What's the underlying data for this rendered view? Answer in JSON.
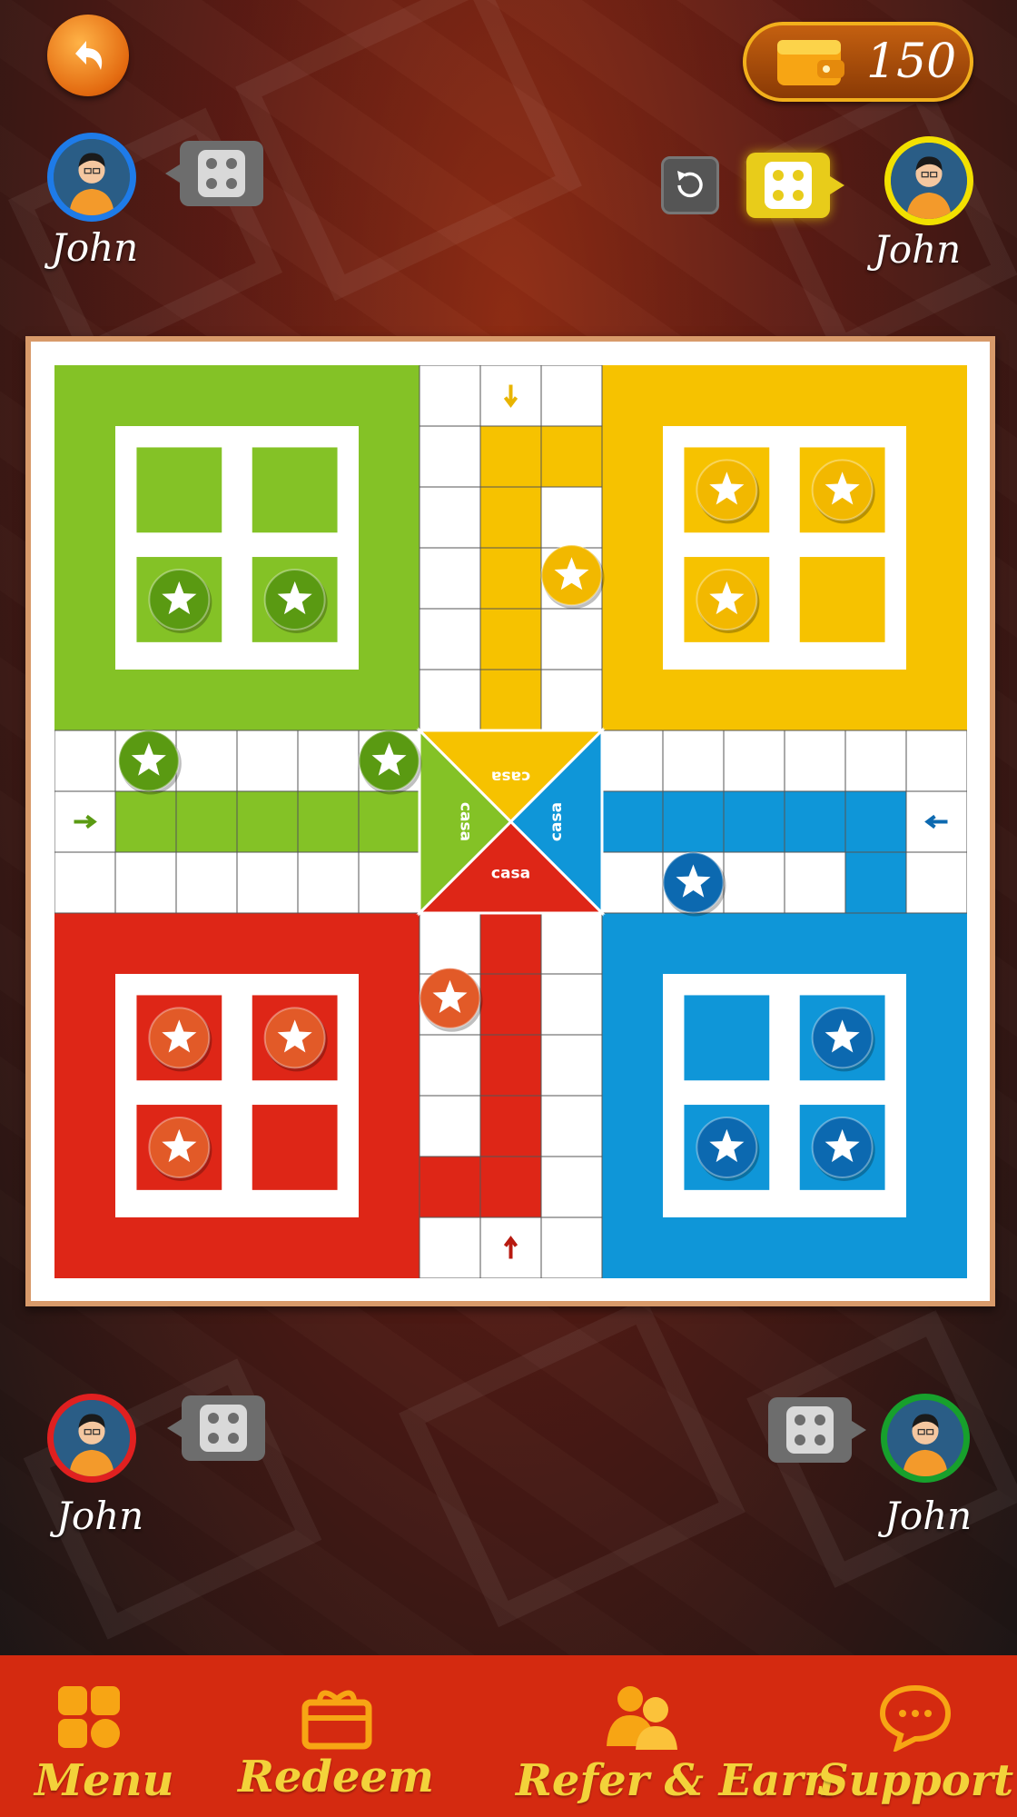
{
  "header": {
    "back_icon": "back-arrow-icon",
    "wallet_icon": "wallet-icon",
    "coins": "150",
    "undo_icon": "undo-icon"
  },
  "players": {
    "blue": {
      "name": "John",
      "ring_color": "#1e7be8"
    },
    "yellow": {
      "name": "John",
      "ring_color": "#f2e000"
    },
    "red": {
      "name": "John",
      "ring_color": "#e02020"
    },
    "green": {
      "name": "John",
      "ring_color": "#17a02c"
    }
  },
  "board": {
    "center_labels": [
      "casa",
      "casa",
      "casa",
      "casa"
    ],
    "colors": {
      "green": "#84c226",
      "yellow": "#f6c200",
      "blue": "#0f96d8",
      "red": "#de2617",
      "green_token": "#5a9a12",
      "yellow_token": "#f2b800",
      "blue_token": "#0c69b0",
      "red_token": "#e25a28"
    },
    "dice_value": 4
  },
  "nav": {
    "menu_label": "Menu",
    "redeem_label": "Redeem",
    "refer_label": "Refer & Earn",
    "support_label": "Support",
    "menu_icon": "grid-icon",
    "redeem_icon": "gift-icon",
    "refer_icon": "people-icon",
    "support_icon": "chat-icon"
  }
}
